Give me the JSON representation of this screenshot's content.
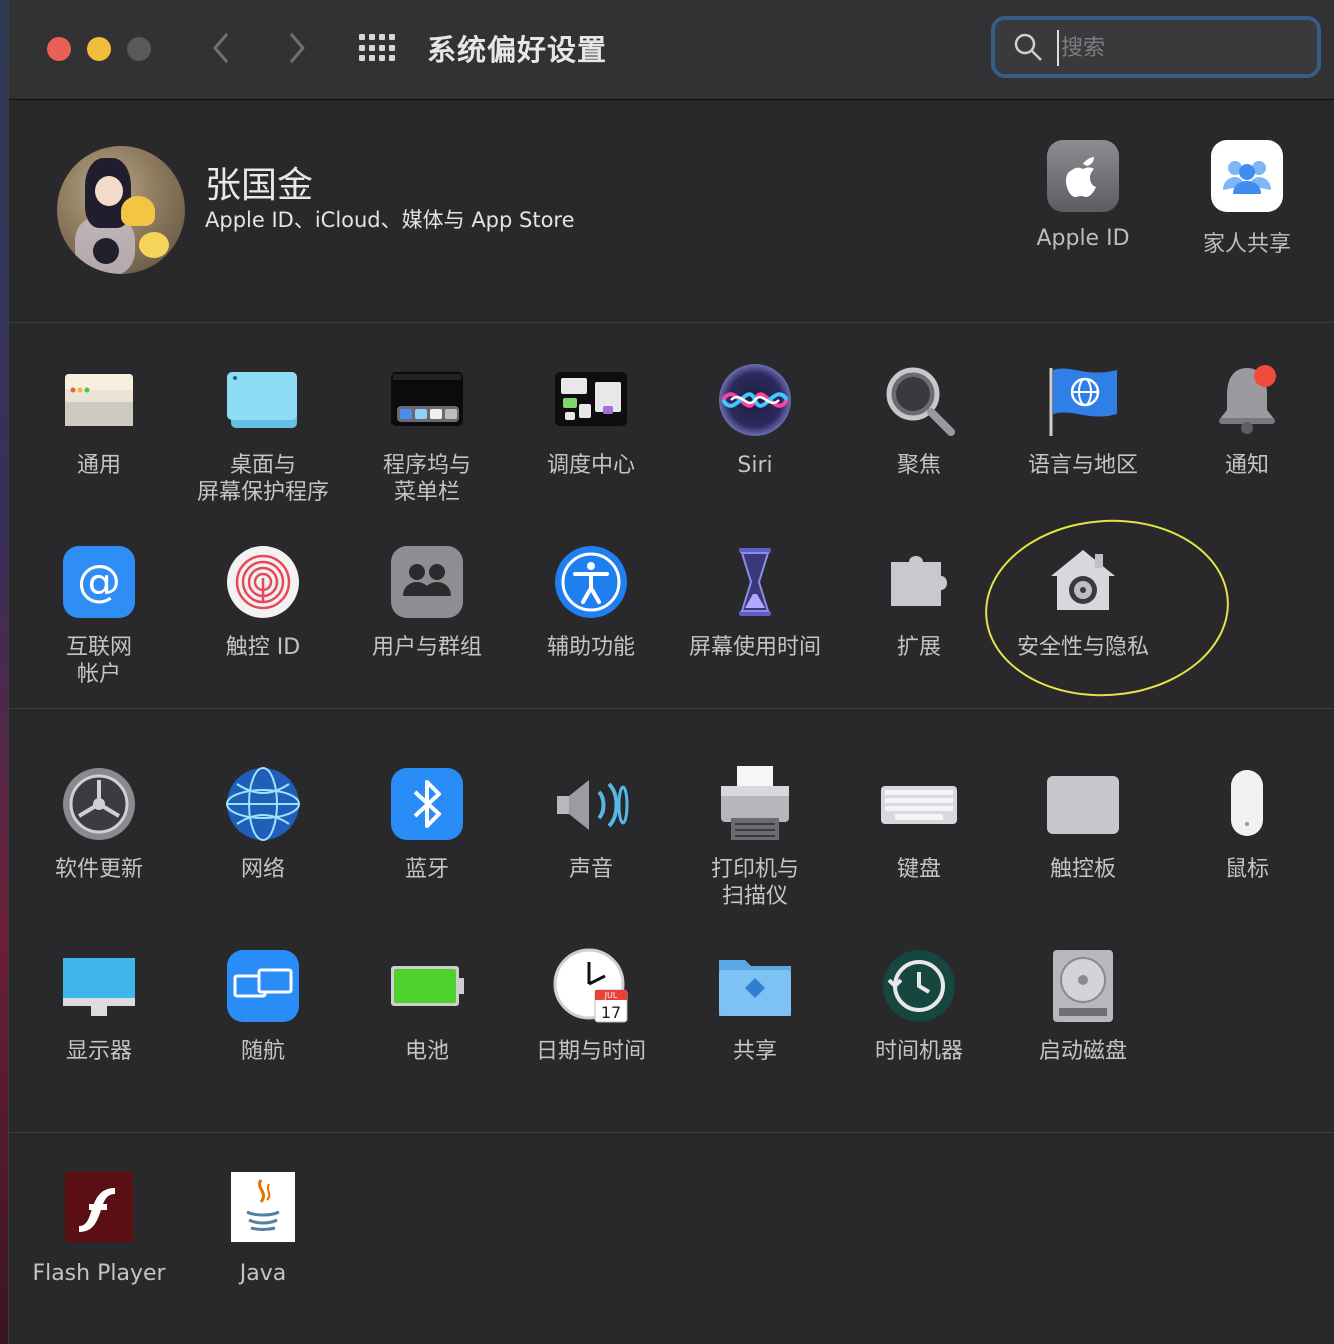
{
  "window": {
    "title": "系统偏好设置"
  },
  "search": {
    "placeholder": "搜索",
    "value": ""
  },
  "account": {
    "name": "张国金",
    "subtitle": "Apple ID、iCloud、媒体与 App Store",
    "quick_items": [
      {
        "label": "Apple ID",
        "icon": "apple-logo-icon"
      },
      {
        "label": "家人共享",
        "icon": "family-sharing-icon"
      }
    ]
  },
  "section1": [
    {
      "label": "通用",
      "icon": "general-icon"
    },
    {
      "label": "桌面与\n屏幕保护程序",
      "icon": "desktop-screensaver-icon"
    },
    {
      "label": "程序坞与\n菜单栏",
      "icon": "dock-menubar-icon"
    },
    {
      "label": "调度中心",
      "icon": "mission-control-icon"
    },
    {
      "label": "Siri",
      "icon": "siri-icon"
    },
    {
      "label": "聚焦",
      "icon": "spotlight-icon"
    },
    {
      "label": "语言与地区",
      "icon": "language-region-icon"
    },
    {
      "label": "通知",
      "icon": "notifications-icon"
    },
    {
      "label": "互联网\n帐户",
      "icon": "internet-accounts-icon"
    },
    {
      "label": "触控 ID",
      "icon": "touch-id-icon"
    },
    {
      "label": "用户与群组",
      "icon": "users-groups-icon"
    },
    {
      "label": "辅助功能",
      "icon": "accessibility-icon"
    },
    {
      "label": "屏幕使用时间",
      "icon": "screen-time-icon"
    },
    {
      "label": "扩展",
      "icon": "extensions-icon"
    },
    {
      "label": "安全性与隐私",
      "icon": "security-privacy-icon"
    }
  ],
  "section2": [
    {
      "label": "软件更新",
      "icon": "software-update-icon"
    },
    {
      "label": "网络",
      "icon": "network-icon"
    },
    {
      "label": "蓝牙",
      "icon": "bluetooth-icon"
    },
    {
      "label": "声音",
      "icon": "sound-icon"
    },
    {
      "label": "打印机与\n扫描仪",
      "icon": "printers-scanners-icon"
    },
    {
      "label": "键盘",
      "icon": "keyboard-icon"
    },
    {
      "label": "触控板",
      "icon": "trackpad-icon"
    },
    {
      "label": "鼠标",
      "icon": "mouse-icon"
    },
    {
      "label": "显示器",
      "icon": "displays-icon"
    },
    {
      "label": "随航",
      "icon": "sidecar-icon"
    },
    {
      "label": "电池",
      "icon": "battery-icon"
    },
    {
      "label": "日期与时间",
      "icon": "date-time-icon"
    },
    {
      "label": "共享",
      "icon": "sharing-icon"
    },
    {
      "label": "时间机器",
      "icon": "time-machine-icon"
    },
    {
      "label": "启动磁盘",
      "icon": "startup-disk-icon"
    }
  ],
  "section3": [
    {
      "label": "Flash Player",
      "icon": "flash-player-icon"
    },
    {
      "label": "Java",
      "icon": "java-icon"
    }
  ],
  "calendar_icon": {
    "month": "JUL",
    "day": "17"
  },
  "colors": {
    "accent": "#365d84",
    "annotation": "#e6e34a",
    "background": "#29282b"
  }
}
